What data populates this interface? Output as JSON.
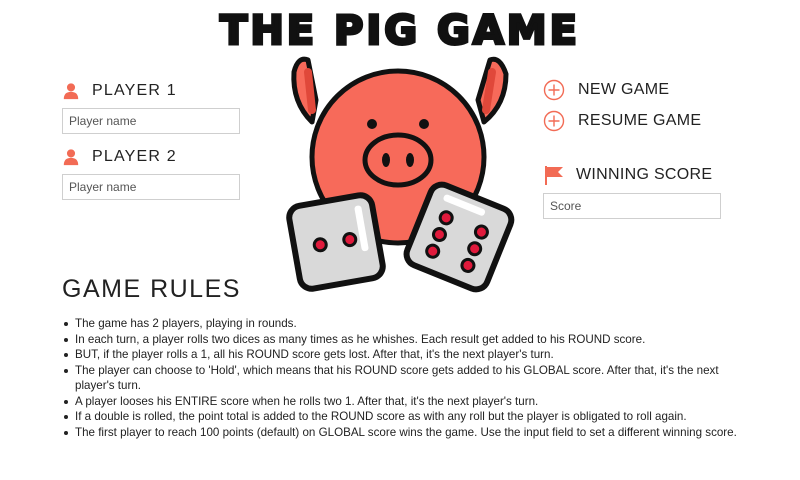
{
  "title": "THE PIG GAME",
  "players": [
    {
      "label": "PLAYER 1",
      "placeholder": "Player name"
    },
    {
      "label": "PLAYER 2",
      "placeholder": "Player name"
    }
  ],
  "menu": {
    "new_game": "NEW GAME",
    "resume_game": "RESUME GAME"
  },
  "winning_score": {
    "label": "WINNING SCORE",
    "placeholder": "Score"
  },
  "rules": {
    "heading": "GAME RULES",
    "items": [
      "The game has 2 players, playing in rounds.",
      "In each turn, a player rolls two dices as many times as he whishes. Each result get added to his ROUND score.",
      "BUT, if the player rolls a 1, all his ROUND score gets lost. After that, it's the next player's turn.",
      "The player can choose to 'Hold', which means that his ROUND score gets added to his GLOBAL score. After that, it's the next player's turn.",
      "A player looses his ENTIRE score when he rolls two 1. After that, it's the next player's turn.",
      "If a double is rolled, the point total is added to the ROUND score as with any roll but the player is obligated to roll again.",
      "The first player to reach 100 points (default) on GLOBAL score wins the game. Use the input field to set a different winning score."
    ]
  },
  "icons": {
    "player": "user-icon",
    "menu": "plus-circle-icon",
    "winning": "flag-icon",
    "illustration": "pig-with-dice-illustration"
  },
  "colors": {
    "accent": "#f26b55",
    "pig_body": "#f76a5a",
    "pig_dark": "#e0483a",
    "dice_face": "#d9d9d9",
    "dice_pip": "#e01a3c",
    "outline": "#111111"
  },
  "dice": [
    {
      "value": 2
    },
    {
      "value": 6
    }
  ]
}
